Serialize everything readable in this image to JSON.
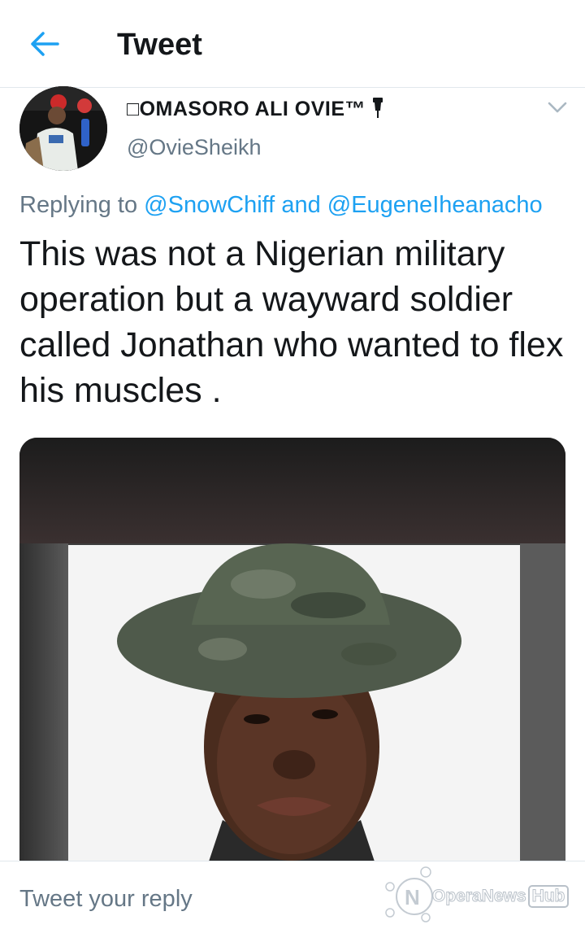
{
  "header": {
    "title": "Tweet"
  },
  "user": {
    "display_name": "□OMASORO ALI OVIE™",
    "handle": "@OvieSheikh"
  },
  "reply_context": {
    "prefix": "Replying to",
    "mention1": "@SnowChiff",
    "joiner": "and",
    "mention2": "@EugeneIheanacho"
  },
  "tweet": {
    "text": "This was not a Nigerian military operation but a wayward soldier called Jonathan who wanted to flex his muscles ."
  },
  "reply_bar": {
    "placeholder": "Tweet your reply"
  },
  "watermark": {
    "brand": "OperaNews",
    "suffix": "Hub"
  },
  "colors": {
    "accent": "#1da1f2",
    "secondary_text": "#657786",
    "primary_text": "#14171a"
  }
}
